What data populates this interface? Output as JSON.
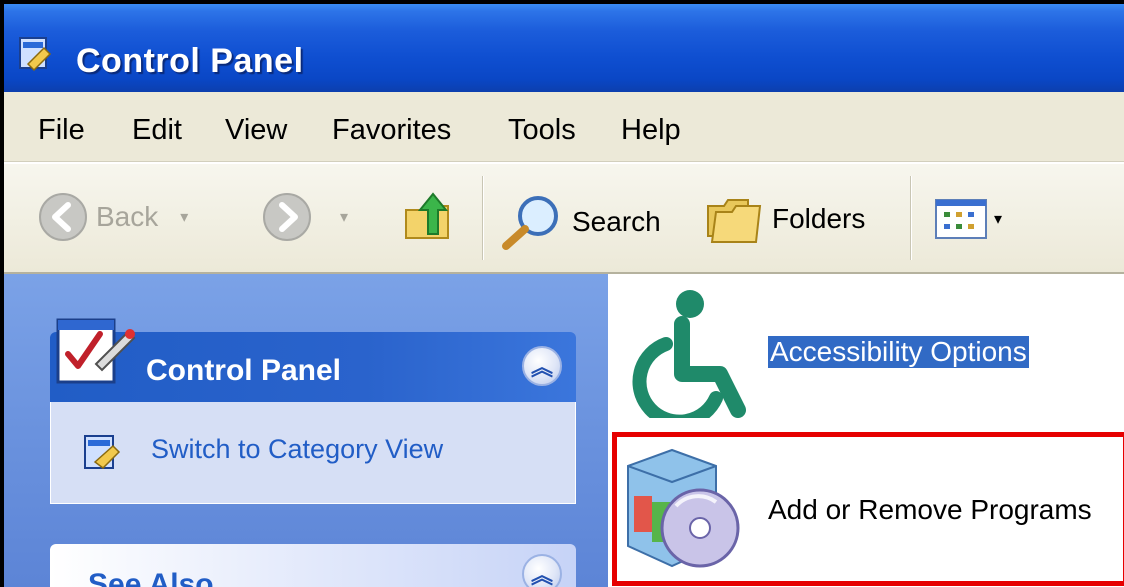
{
  "window": {
    "title": "Control Panel"
  },
  "menu": [
    "File",
    "Edit",
    "View",
    "Favorites",
    "Tools",
    "Help"
  ],
  "toolbar": {
    "back_label": "Back",
    "search_label": "Search",
    "folders_label": "Folders"
  },
  "taskpane": {
    "control_panel": {
      "title": "Control Panel",
      "switch_link": "Switch to Category View"
    },
    "see_also": {
      "title": "See Also"
    }
  },
  "items": [
    {
      "label": "Accessibility Options",
      "selected": true,
      "icon": "accessibility-icon"
    },
    {
      "label": "Add or Remove Programs",
      "selected": false,
      "highlighted": true,
      "icon": "add-remove-programs-icon"
    }
  ],
  "colors": {
    "title_bar": "#0a47c6",
    "task_pane": "#6a92de",
    "selection": "#316ac5",
    "highlight_box": "#e60000"
  }
}
